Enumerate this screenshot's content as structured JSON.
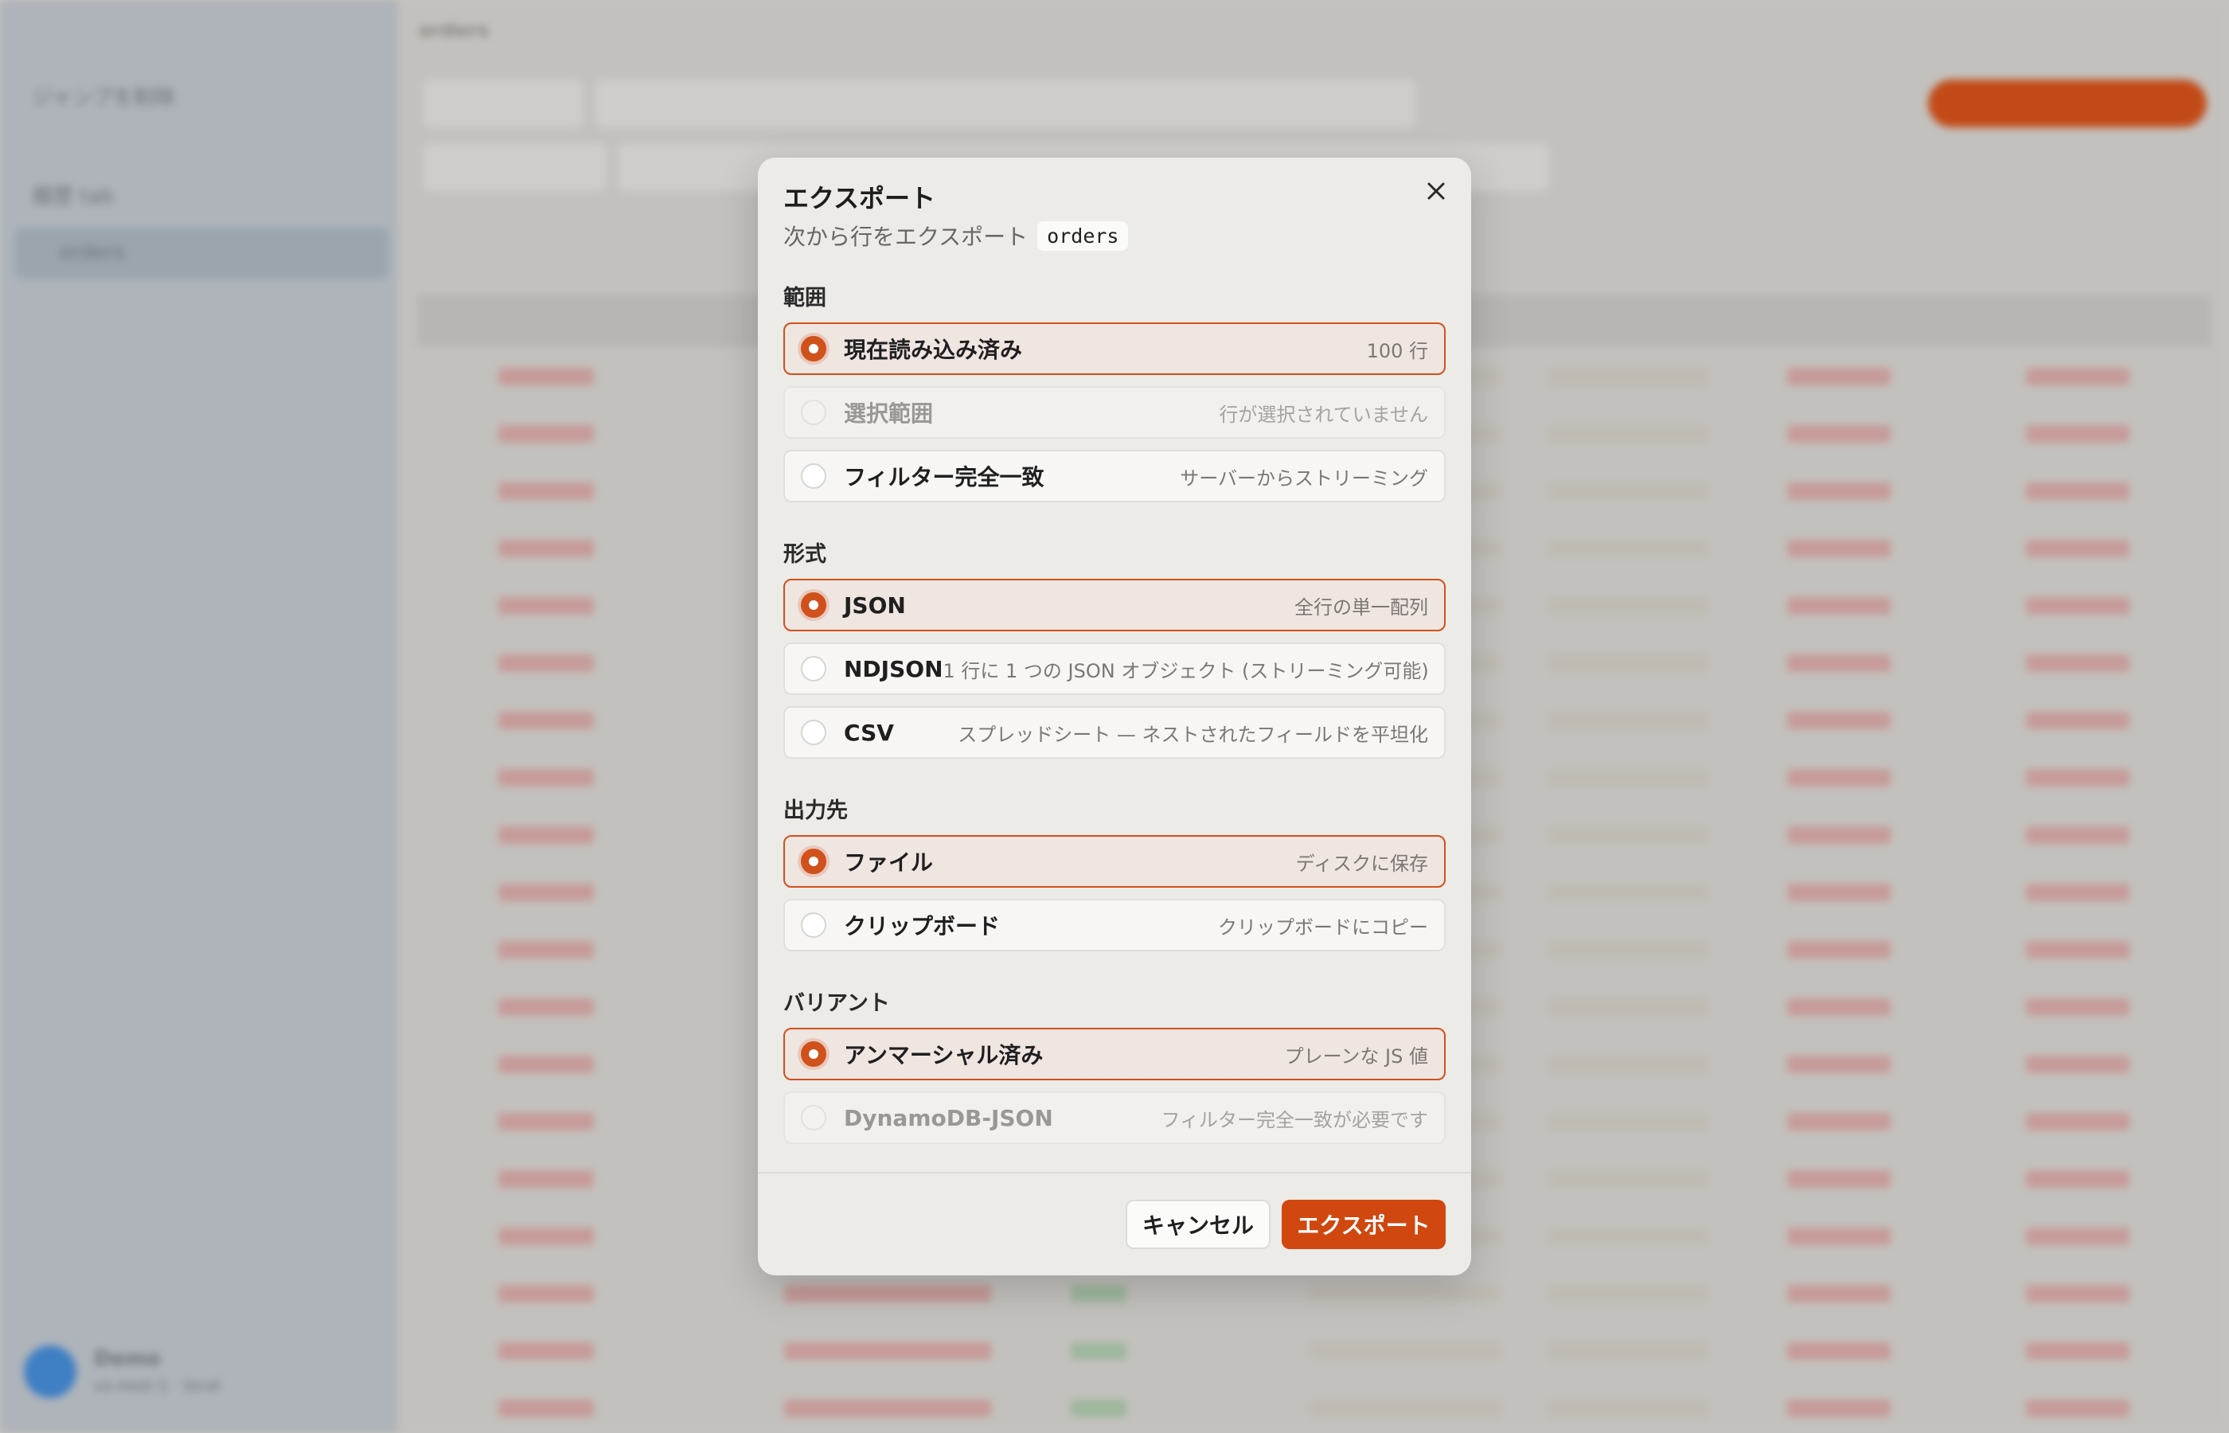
{
  "background": {
    "sidebar_back_label": "ジャンプを削除",
    "sidebar_item_1": "履歴 tab",
    "sidebar_item_2": "orders",
    "table_name": "orders",
    "user_name": "Demo",
    "user_sub": "us-east-1 · local"
  },
  "dialog": {
    "title": "エクスポート",
    "subtitle_prefix": "次から行をエクスポート",
    "table_name": "orders",
    "sections": {
      "range": {
        "label": "範囲",
        "options": [
          {
            "label": "現在読み込み済み",
            "desc": "100 行",
            "state": "selected"
          },
          {
            "label": "選択範囲",
            "desc": "行が選択されていません",
            "state": "disabled"
          },
          {
            "label": "フィルター完全一致",
            "desc": "サーバーからストリーミング",
            "state": "normal"
          }
        ]
      },
      "format": {
        "label": "形式",
        "options": [
          {
            "label": "JSON",
            "desc": "全行の単一配列",
            "state": "selected"
          },
          {
            "label": "NDJSON",
            "desc": "1 行に 1 つの JSON オブジェクト (ストリーミング可能)",
            "state": "normal"
          },
          {
            "label": "CSV",
            "desc": "スプレッドシート — ネストされたフィールドを平坦化",
            "state": "normal"
          }
        ]
      },
      "destination": {
        "label": "出力先",
        "options": [
          {
            "label": "ファイル",
            "desc": "ディスクに保存",
            "state": "selected"
          },
          {
            "label": "クリップボード",
            "desc": "クリップボードにコピー",
            "state": "normal"
          }
        ]
      },
      "variant": {
        "label": "バリアント",
        "options": [
          {
            "label": "アンマーシャル済み",
            "desc": "プレーンな JS 値",
            "state": "selected"
          },
          {
            "label": "DynamoDB-JSON",
            "desc": "フィルター完全一致が必要です",
            "state": "disabled"
          }
        ]
      }
    },
    "cancel_label": "キャンセル",
    "export_label": "エクスポート"
  },
  "colors": {
    "accent": "#d0511c",
    "export_button": "#d0470f"
  },
  "icons": {
    "close": "close-icon"
  }
}
